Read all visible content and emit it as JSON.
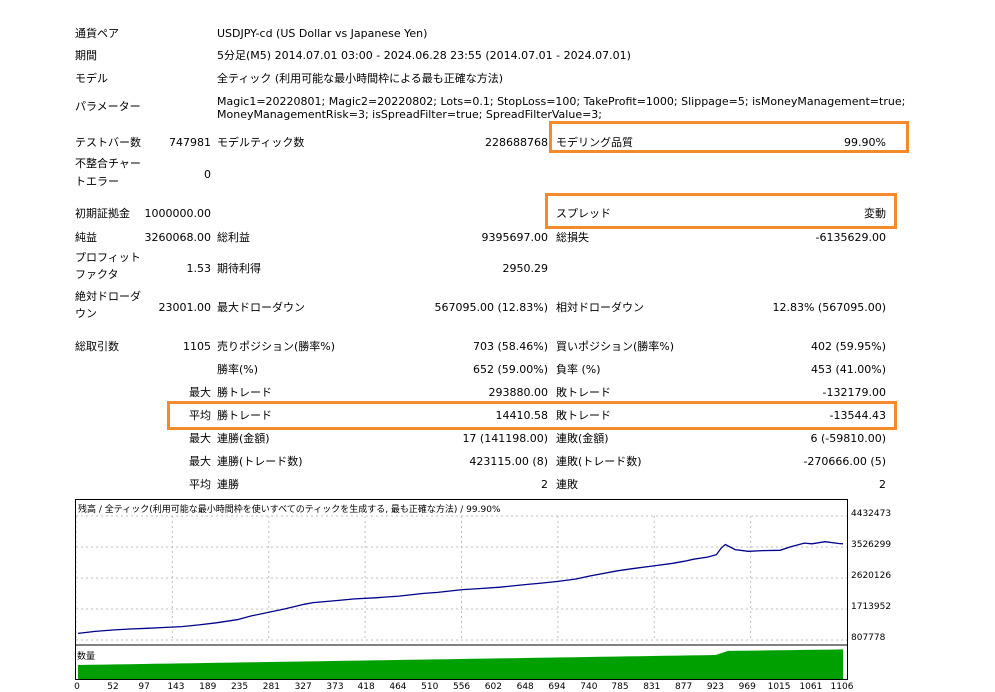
{
  "report": {
    "pair_label": "通貨ペア",
    "pair_value": "USDJPY-cd (US Dollar vs Japanese Yen)",
    "period_label": "期間",
    "period_value": "5分足(M5) 2014.07.01 03:00 - 2024.06.28 23:55 (2014.07.01 - 2024.07.01)",
    "model_label": "モデル",
    "model_value": "全ティック (利用可能な最小時間枠による最も正確な方法)",
    "params_label": "パラメーター",
    "params_line1": "Magic1=20220801; Magic2=20220802; Lots=0.1; StopLoss=100; TakeProfit=1000; Slippage=5; isMoneyManagement=true;",
    "params_line2": "MoneyManagementRisk=3; isSpreadFilter=true; SpreadFilterValue=3;",
    "bars_label": "テストバー数",
    "bars_value": "747981",
    "ticks_label": "モデルティック数",
    "ticks_value": "228688768",
    "quality_label": "モデリング品質",
    "quality_value": "99.90%",
    "mismatch_label1": "不整合チャー",
    "mismatch_label2": "トエラー",
    "mismatch_value": "0",
    "deposit_label": "初期証拠金",
    "deposit_value": "1000000.00",
    "spread_label": "スプレッド",
    "spread_value": "変動",
    "net_label": "純益",
    "net_value": "3260068.00",
    "gross_profit_label": "総利益",
    "gross_profit_value": "9395697.00",
    "gross_loss_label": "総損失",
    "gross_loss_value": "-6135629.00",
    "pf_label1": "プロフィット",
    "pf_label2": "ファクタ",
    "pf_value": "1.53",
    "expected_label": "期待利得",
    "expected_value": "2950.29",
    "abs_dd_label1": "絶対ドローダ",
    "abs_dd_label2": "ウン",
    "abs_dd_value": "23001.00",
    "max_dd_label": "最大ドローダウン",
    "max_dd_value": "567095.00 (12.83%)",
    "rel_dd_label": "相対ドローダウン",
    "rel_dd_value": "12.83% (567095.00)",
    "total_trades_label": "総取引数",
    "total_trades_value": "1105",
    "short_label": "売りポジション(勝率%)",
    "short_value": "703 (58.46%)",
    "long_label": "買いポジション(勝率%)",
    "long_value": "402 (59.95%)",
    "win_rate_label": "勝率(%)",
    "win_rate_value": "652 (59.00%)",
    "loss_rate_label": "負率 (%)",
    "loss_rate_value": "453 (41.00%)",
    "max1": "最大",
    "max_win_label": "勝トレード",
    "max_win_value": "293880.00",
    "max_loss_label": "敗トレード",
    "max_loss_value": "-132179.00",
    "avg1": "平均",
    "avg_win_label": "勝トレード",
    "avg_win_value": "14410.58",
    "avg_loss_label": "敗トレード",
    "avg_loss_value": "-13544.43",
    "max2": "最大",
    "cons_wins_amt_label": "連勝(金額)",
    "cons_wins_amt_value": "17 (141198.00)",
    "cons_loss_amt_label": "連敗(金額)",
    "cons_loss_amt_value": "6 (-59810.00)",
    "max3": "最大",
    "cons_wins_cnt_label": "連勝(トレード数)",
    "cons_wins_cnt_value": "423115.00 (8)",
    "cons_loss_cnt_label": "連敗(トレード数)",
    "cons_loss_cnt_value": "-270666.00 (5)",
    "avg2": "平均",
    "avg_wins_label": "連勝",
    "avg_wins_value": "2",
    "avg_loss_run_label": "連敗",
    "avg_loss_run_value": "2"
  },
  "chart_header": "残高 / 全ティック(利用可能な最小時間枠を使いすべてのティックを生成する, 最も正確な方法) / 99.90%",
  "volume_header": "数量",
  "chart_data": {
    "type": "line",
    "y_ticks": [
      "4432473",
      "3526299",
      "2620126",
      "1713952",
      "807778"
    ],
    "x_ticks": [
      "0",
      "52",
      "97",
      "143",
      "189",
      "235",
      "281",
      "327",
      "373",
      "418",
      "464",
      "510",
      "556",
      "602",
      "648",
      "694",
      "740",
      "785",
      "831",
      "877",
      "923",
      "969",
      "1015",
      "1061",
      "1106"
    ],
    "series": [
      {
        "x": [
          0,
          25,
          50,
          75,
          100,
          120,
          150,
          175,
          200,
          230,
          250,
          300,
          327,
          340,
          373,
          400,
          430,
          464,
          500,
          520,
          556,
          580,
          610,
          648,
          670,
          694,
          720,
          740,
          780,
          800,
          831,
          860,
          877,
          890,
          910,
          923,
          930,
          936,
          950,
          969,
          990,
          1015,
          1030,
          1050,
          1061,
          1080,
          1100,
          1106
        ],
        "values": [
          1000000,
          1060000,
          1100000,
          1130000,
          1150000,
          1170000,
          1200000,
          1250000,
          1310000,
          1400000,
          1510000,
          1720000,
          1850000,
          1900000,
          1960000,
          2010000,
          2040000,
          2090000,
          2170000,
          2200000,
          2280000,
          2310000,
          2350000,
          2430000,
          2470000,
          2520000,
          2590000,
          2680000,
          2830000,
          2890000,
          2970000,
          3050000,
          3110000,
          3170000,
          3230000,
          3300000,
          3500000,
          3600000,
          3450000,
          3400000,
          3420000,
          3430000,
          3530000,
          3640000,
          3620000,
          3680000,
          3630000,
          3620000
        ],
        "color": "#00008b"
      }
    ],
    "ylim": [
      807778,
      4432473
    ],
    "xlim": [
      0,
      1106
    ]
  },
  "volume_color": "#00a000",
  "grid_color": "#c0c0c0",
  "highlight_color": "#f58a2a"
}
